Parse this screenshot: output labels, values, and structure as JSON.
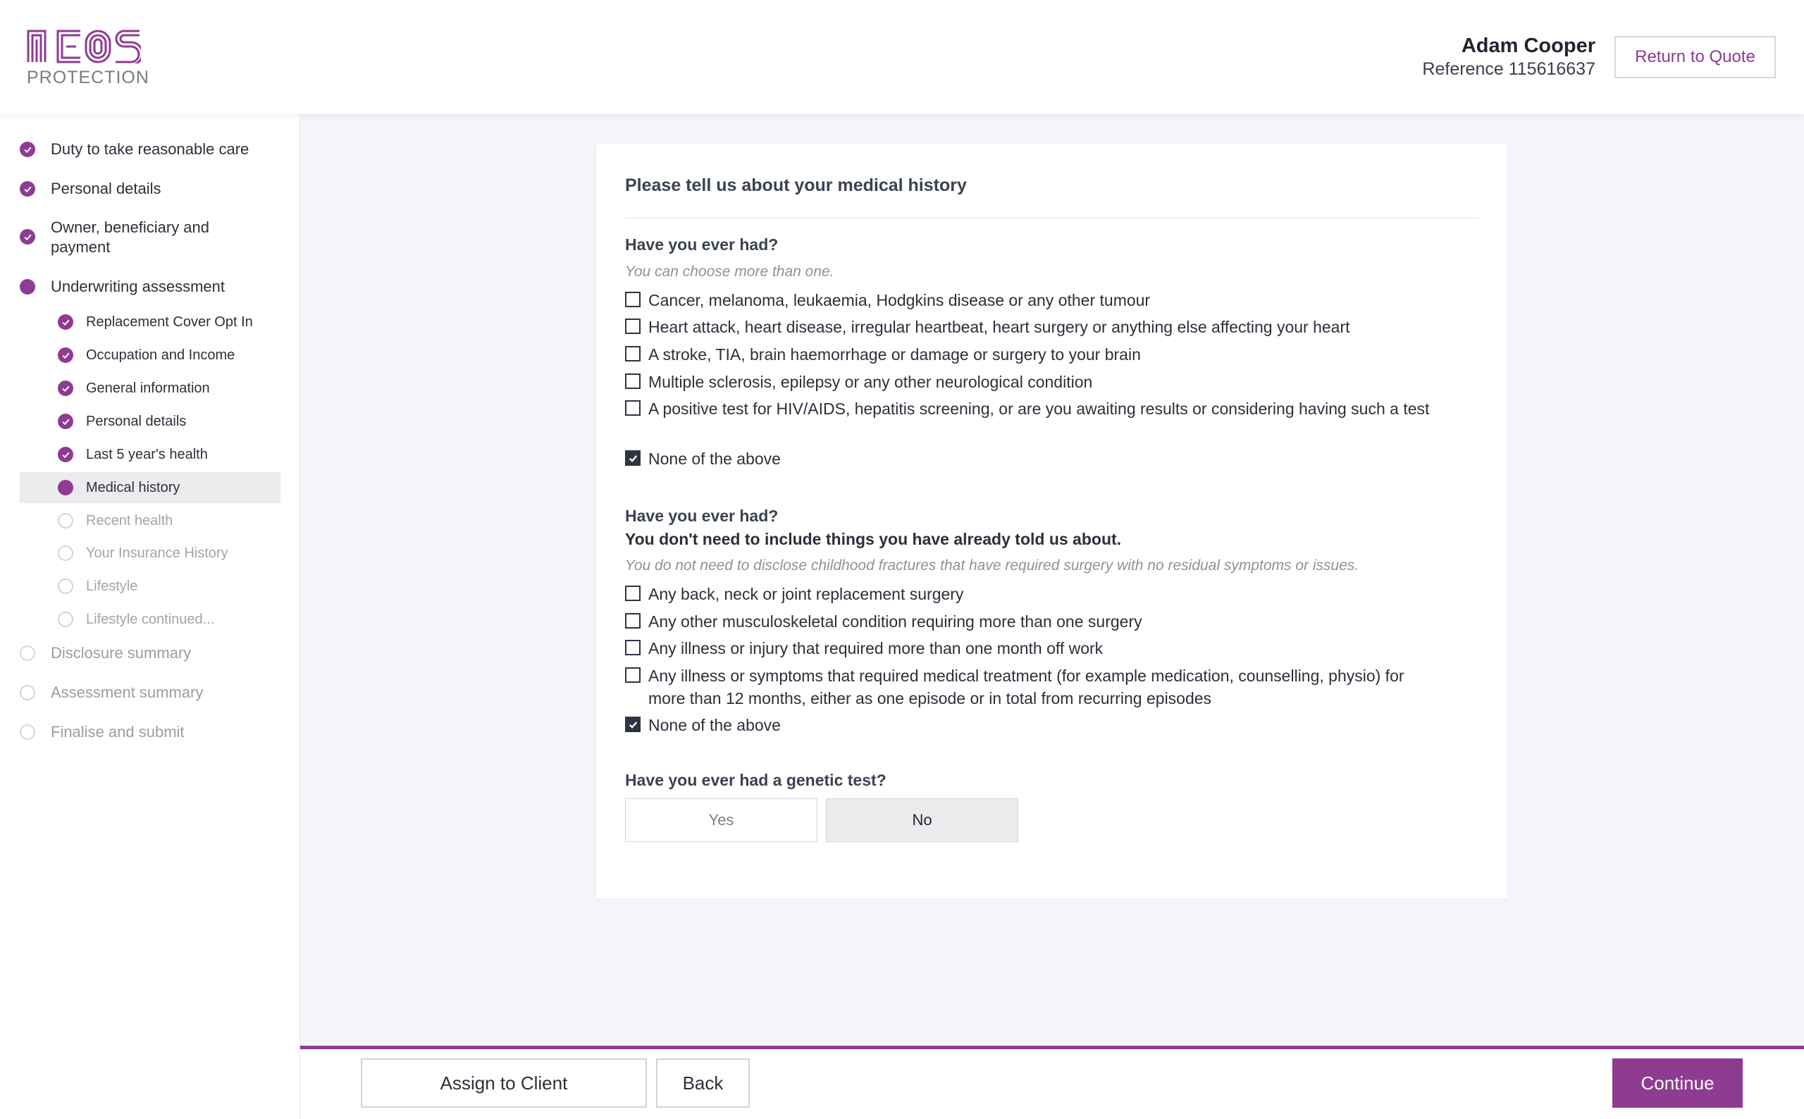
{
  "brand": {
    "logo_word": "NEOS",
    "logo_sub": "PROTECTION",
    "accent_color": "#8e3b92"
  },
  "header": {
    "user_name": "Adam Cooper",
    "reference": "Reference 115616637",
    "return_label": "Return to Quote"
  },
  "sidebar": {
    "items": [
      {
        "label": "Duty to take reasonable care",
        "state": "done"
      },
      {
        "label": "Personal details",
        "state": "done"
      },
      {
        "label": "Owner, beneficiary and payment",
        "state": "done"
      },
      {
        "label": "Underwriting assessment",
        "state": "current"
      },
      {
        "label": "Disclosure summary",
        "state": "pending"
      },
      {
        "label": "Assessment summary",
        "state": "pending"
      },
      {
        "label": "Finalise and submit",
        "state": "pending"
      }
    ],
    "sub_items": [
      {
        "label": "Replacement Cover Opt In",
        "state": "done"
      },
      {
        "label": "Occupation and Income",
        "state": "done"
      },
      {
        "label": "General information",
        "state": "done"
      },
      {
        "label": "Personal details",
        "state": "done"
      },
      {
        "label": "Last 5 year's health",
        "state": "done"
      },
      {
        "label": "Medical history",
        "state": "current"
      },
      {
        "label": "Recent health",
        "state": "pending"
      },
      {
        "label": "Your Insurance History",
        "state": "pending"
      },
      {
        "label": "Lifestyle",
        "state": "pending"
      },
      {
        "label": "Lifestyle continued...",
        "state": "pending"
      }
    ]
  },
  "form": {
    "title": "Please tell us about your medical history",
    "q1": {
      "title": "Have you ever had?",
      "hint": "You can choose more than one.",
      "options": [
        {
          "label": "Cancer, melanoma, leukaemia, Hodgkins disease or any other tumour",
          "checked": false
        },
        {
          "label": "Heart attack, heart disease, irregular heartbeat, heart surgery or anything else affecting your heart",
          "checked": false
        },
        {
          "label": "A stroke, TIA, brain haemorrhage or damage or surgery to your brain",
          "checked": false
        },
        {
          "label": "Multiple sclerosis, epilepsy or any other neurological condition",
          "checked": false
        },
        {
          "label": "A positive test for HIV/AIDS, hepatitis screening, or are you awaiting results or considering having such a test",
          "checked": false
        },
        {
          "label": "None of the above",
          "checked": true
        }
      ]
    },
    "q2": {
      "title": "Have you ever had?",
      "subtitle": "You don't need to include things you have already told us about.",
      "hint": "You do not need to disclose childhood fractures that have required surgery with no residual symptoms or issues.",
      "options": [
        {
          "label": "Any back, neck or joint replacement surgery",
          "checked": false
        },
        {
          "label": "Any other musculoskeletal condition requiring more than one surgery",
          "checked": false
        },
        {
          "label": "Any illness or injury that required more than one month off work",
          "checked": false
        },
        {
          "label": "Any illness or symptoms that required medical treatment (for example medication, counselling, physio) for more than 12 months, either as one episode or in total from recurring episodes",
          "checked": false
        },
        {
          "label": "None of the above",
          "checked": true
        }
      ]
    },
    "q3": {
      "title": "Have you ever had a genetic test?",
      "yes_label": "Yes",
      "no_label": "No",
      "selected": "No"
    }
  },
  "footer": {
    "assign_label": "Assign to Client",
    "back_label": "Back",
    "continue_label": "Continue"
  }
}
